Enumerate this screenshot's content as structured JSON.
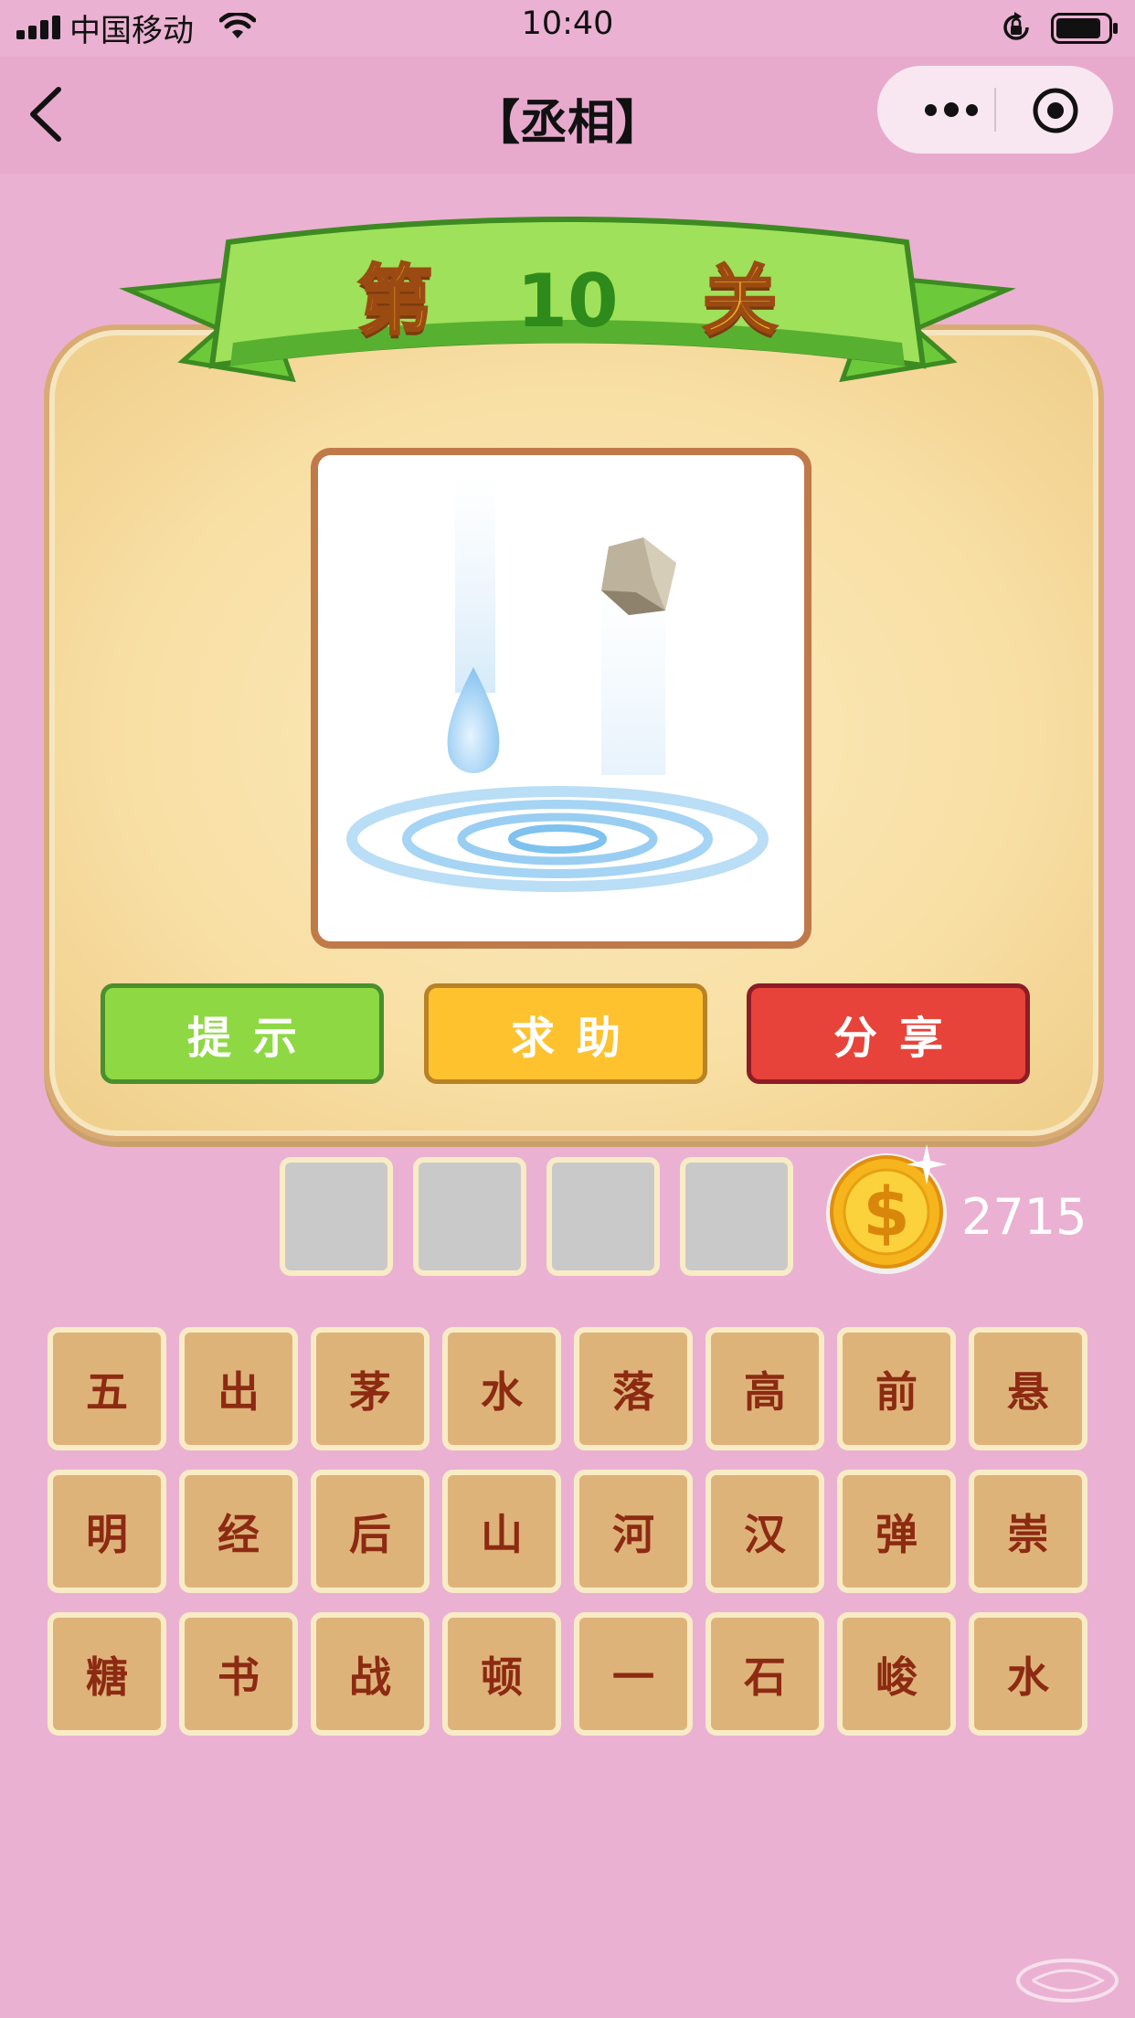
{
  "status_bar": {
    "carrier": "中国移动",
    "time": "10:40"
  },
  "nav": {
    "title": "【丞相】"
  },
  "level": {
    "prefix": "第",
    "number": "10",
    "suffix": "关"
  },
  "actions": {
    "hint": "提示",
    "help": "求助",
    "share": "分享"
  },
  "answer_slots": [
    "",
    "",
    "",
    ""
  ],
  "coins": "2715",
  "letters": {
    "row1": [
      "五",
      "出",
      "茅",
      "水",
      "落",
      "高",
      "前",
      "悬"
    ],
    "row2": [
      "明",
      "经",
      "后",
      "山",
      "河",
      "汉",
      "弹",
      "崇"
    ],
    "row3": [
      "糖",
      "书",
      "战",
      "顿",
      "一",
      "石",
      "峻",
      "水"
    ]
  },
  "colors": {
    "background": "#ebb1d2",
    "hint_button": "#8ed843",
    "help_button": "#fec22f",
    "share_button": "#e8433a",
    "tile": "#deb37a",
    "tile_text": "#8c2a12"
  },
  "icons": [
    "signal-icon",
    "wifi-icon",
    "rotation-lock-icon",
    "battery-icon",
    "back-icon",
    "more-icon",
    "target-icon",
    "coin-icon"
  ]
}
